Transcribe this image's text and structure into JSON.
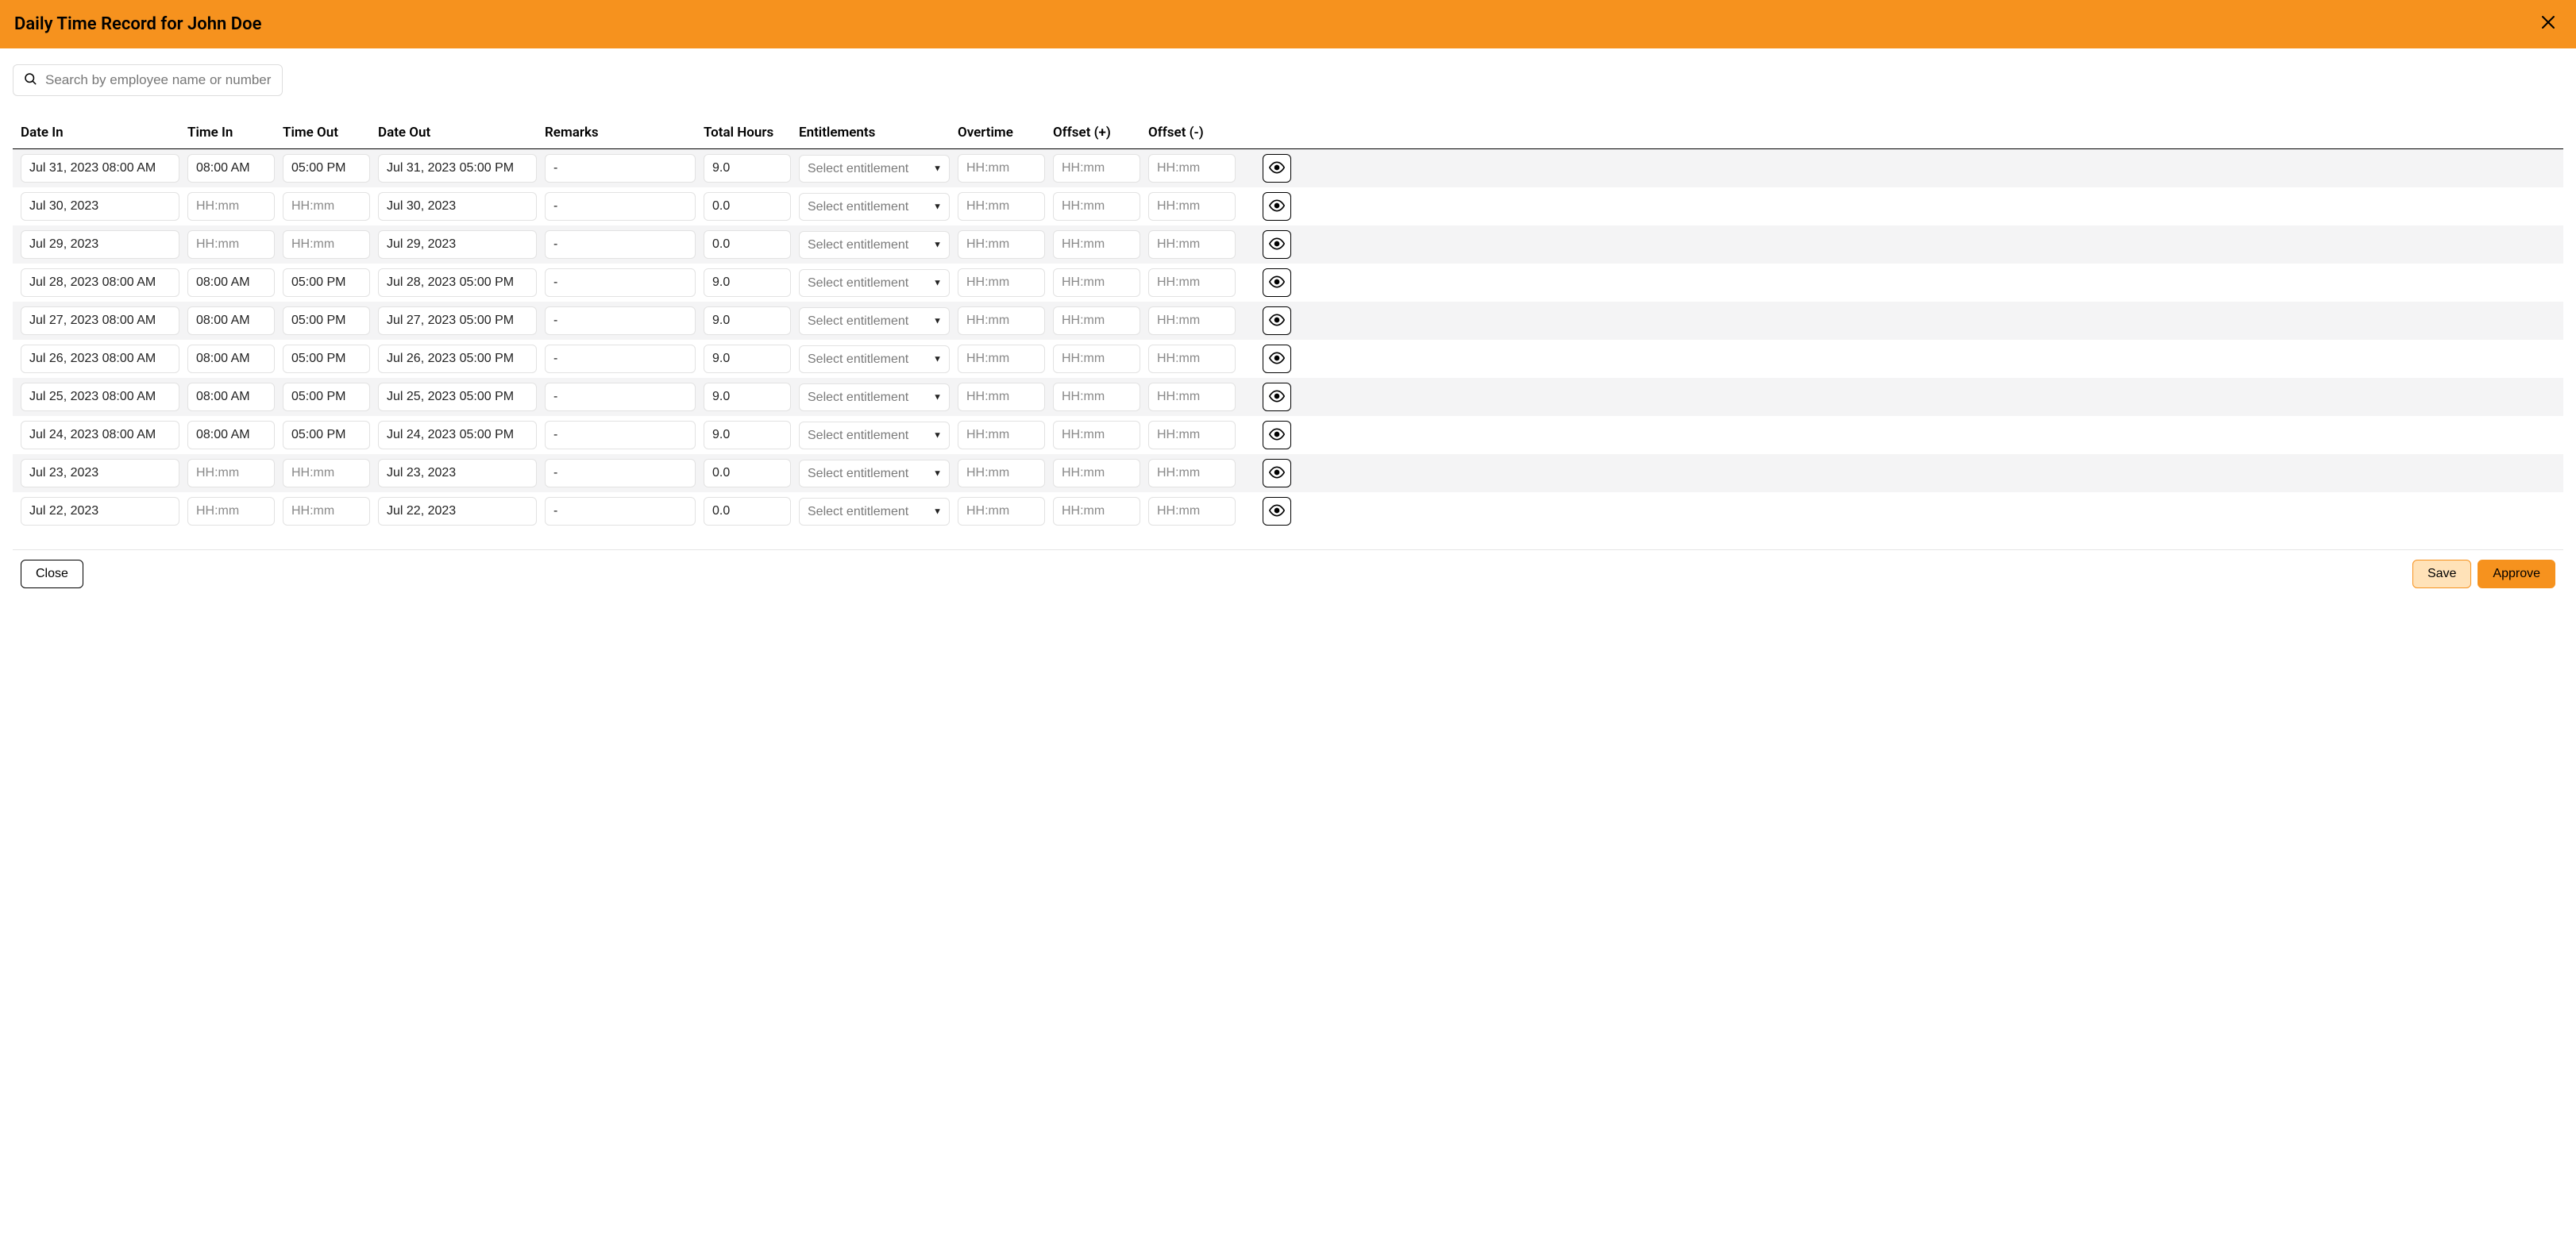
{
  "header": {
    "title": "Daily Time Record for John Doe"
  },
  "search": {
    "placeholder": "Search by employee name or number",
    "value": ""
  },
  "columns": {
    "date_in": "Date In",
    "time_in": "Time In",
    "time_out": "Time Out",
    "date_out": "Date Out",
    "remarks": "Remarks",
    "total_hours": "Total Hours",
    "entitlements": "Entitlements",
    "overtime": "Overtime",
    "offset_plus": "Offset (+)",
    "offset_minus": "Offset (-)"
  },
  "placeholders": {
    "time": "HH:mm"
  },
  "entitlement_options": {
    "default": "Select entitlement"
  },
  "rows": [
    {
      "date_in": "Jul 31, 2023 08:00 AM",
      "time_in": "08:00 AM",
      "time_out": "05:00 PM",
      "date_out": "Jul 31, 2023 05:00 PM",
      "remarks": "-",
      "total_hours": "9.0",
      "entitlement": "",
      "overtime": "",
      "offset_plus": "",
      "offset_minus": ""
    },
    {
      "date_in": "Jul 30, 2023",
      "time_in": "",
      "time_out": "",
      "date_out": "Jul 30, 2023",
      "remarks": "-",
      "total_hours": "0.0",
      "entitlement": "",
      "overtime": "",
      "offset_plus": "",
      "offset_minus": ""
    },
    {
      "date_in": "Jul 29, 2023",
      "time_in": "",
      "time_out": "",
      "date_out": "Jul 29, 2023",
      "remarks": "-",
      "total_hours": "0.0",
      "entitlement": "",
      "overtime": "",
      "offset_plus": "",
      "offset_minus": ""
    },
    {
      "date_in": "Jul 28, 2023 08:00 AM",
      "time_in": "08:00 AM",
      "time_out": "05:00 PM",
      "date_out": "Jul 28, 2023 05:00 PM",
      "remarks": "-",
      "total_hours": "9.0",
      "entitlement": "",
      "overtime": "",
      "offset_plus": "",
      "offset_minus": ""
    },
    {
      "date_in": "Jul 27, 2023 08:00 AM",
      "time_in": "08:00 AM",
      "time_out": "05:00 PM",
      "date_out": "Jul 27, 2023 05:00 PM",
      "remarks": "-",
      "total_hours": "9.0",
      "entitlement": "",
      "overtime": "",
      "offset_plus": "",
      "offset_minus": ""
    },
    {
      "date_in": "Jul 26, 2023 08:00 AM",
      "time_in": "08:00 AM",
      "time_out": "05:00 PM",
      "date_out": "Jul 26, 2023 05:00 PM",
      "remarks": "-",
      "total_hours": "9.0",
      "entitlement": "",
      "overtime": "",
      "offset_plus": "",
      "offset_minus": ""
    },
    {
      "date_in": "Jul 25, 2023 08:00 AM",
      "time_in": "08:00 AM",
      "time_out": "05:00 PM",
      "date_out": "Jul 25, 2023 05:00 PM",
      "remarks": "-",
      "total_hours": "9.0",
      "entitlement": "",
      "overtime": "",
      "offset_plus": "",
      "offset_minus": ""
    },
    {
      "date_in": "Jul 24, 2023 08:00 AM",
      "time_in": "08:00 AM",
      "time_out": "05:00 PM",
      "date_out": "Jul 24, 2023 05:00 PM",
      "remarks": "-",
      "total_hours": "9.0",
      "entitlement": "",
      "overtime": "",
      "offset_plus": "",
      "offset_minus": ""
    },
    {
      "date_in": "Jul 23, 2023",
      "time_in": "",
      "time_out": "",
      "date_out": "Jul 23, 2023",
      "remarks": "-",
      "total_hours": "0.0",
      "entitlement": "",
      "overtime": "",
      "offset_plus": "",
      "offset_minus": ""
    },
    {
      "date_in": "Jul 22, 2023",
      "time_in": "",
      "time_out": "",
      "date_out": "Jul 22, 2023",
      "remarks": "-",
      "total_hours": "0.0",
      "entitlement": "",
      "overtime": "",
      "offset_plus": "",
      "offset_minus": ""
    }
  ],
  "footer": {
    "close": "Close",
    "save": "Save",
    "approve": "Approve"
  }
}
